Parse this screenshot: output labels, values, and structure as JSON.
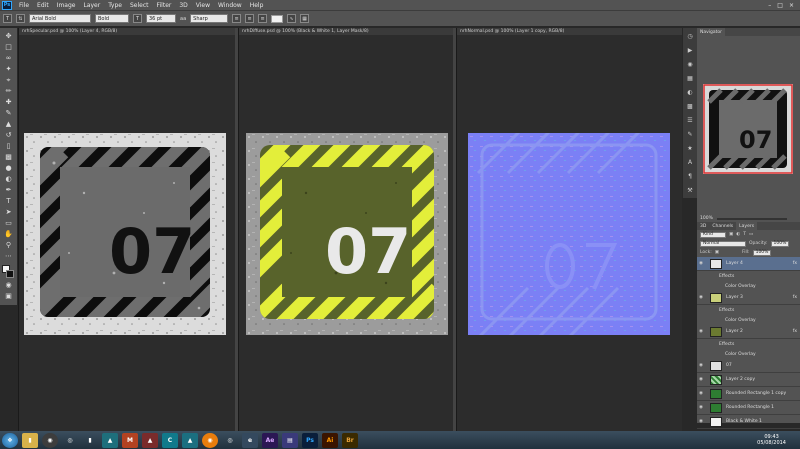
{
  "app": {
    "logo": "Ps"
  },
  "menu": [
    "File",
    "Edit",
    "Image",
    "Layer",
    "Type",
    "Select",
    "Filter",
    "3D",
    "View",
    "Window",
    "Help"
  ],
  "options": {
    "tool_icon": "T",
    "font_family": "Arial Bold",
    "font_style": "Bold",
    "font_size": "36 pt",
    "aa_label": "aa",
    "antialias": "Sharp"
  },
  "documents": [
    {
      "tab": "nrhSpecular.psd @ 100% (Layer 4, RGB/8)",
      "number": "07"
    },
    {
      "tab": "nrhDiffuse.psd @ 100% (Black & White 1, Layer Mask/8)",
      "number": "07"
    },
    {
      "tab": "nrhNormal.psd @ 100% (Layer 1 copy, RGB/8)"
    }
  ],
  "navigator": {
    "tab": "Navigator",
    "number": "07",
    "zoom": "100%"
  },
  "layers_panel": {
    "tabs": [
      "3D",
      "Channels",
      "Layers"
    ],
    "kind": "Kind",
    "blend": "Normal",
    "opacity_label": "Opacity:",
    "opacity": "100%",
    "lock_label": "Lock:",
    "fill_label": "Fill:",
    "fill": "100%",
    "layers": [
      {
        "name": "Layer 4",
        "fx": "fx",
        "effects": [
          "Effects",
          "Color Overlay"
        ]
      },
      {
        "name": "Layer 3",
        "fx": "fx",
        "effects": [
          "Effects",
          "Color Overlay"
        ]
      },
      {
        "name": "Layer 2",
        "fx": "fx",
        "effects": [
          "Effects",
          "Color Overlay"
        ]
      },
      {
        "name": "07"
      },
      {
        "name": "Layer 2 copy"
      },
      {
        "name": "Rounded Rectangle 1 copy"
      },
      {
        "name": "Rounded Rectangle 1"
      },
      {
        "name": "Black & White 1"
      }
    ]
  },
  "taskbar": {
    "apps": [
      "e",
      "Ae",
      "Ps",
      "Ai",
      "Br"
    ],
    "time": "09:43",
    "date": "05/08/2014"
  },
  "colors": {
    "yellow": "#e3ee3a",
    "olive": "#58632b",
    "normal_blue": "#7b80f5",
    "grey_plate": "#6e6e6e"
  }
}
